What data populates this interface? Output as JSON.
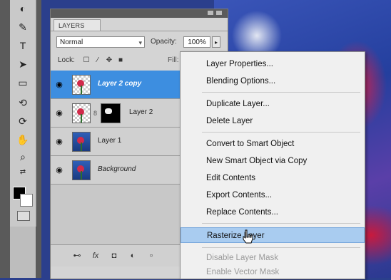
{
  "panel": {
    "tab_label": "LAYERS",
    "blend_mode": "Normal",
    "opacity_label": "Opacity:",
    "opacity_value": "100%",
    "lock_label": "Lock:",
    "fill_label": "Fill:",
    "layers": [
      {
        "name": "Layer 2 copy",
        "selected": true,
        "visible": true
      },
      {
        "name": "Layer 2",
        "selected": false,
        "visible": true,
        "has_mask": true
      },
      {
        "name": "Layer 1",
        "selected": false,
        "visible": true
      },
      {
        "name": "Background",
        "selected": false,
        "visible": true
      }
    ]
  },
  "context_menu": {
    "items": [
      {
        "label": "Layer Properties...",
        "state": "enabled"
      },
      {
        "label": "Blending Options...",
        "state": "enabled"
      },
      {
        "label": "Duplicate Layer...",
        "state": "enabled"
      },
      {
        "label": "Delete Layer",
        "state": "enabled"
      },
      {
        "label": "Convert to Smart Object",
        "state": "enabled"
      },
      {
        "label": "New Smart Object via Copy",
        "state": "enabled"
      },
      {
        "label": "Edit Contents",
        "state": "enabled"
      },
      {
        "label": "Export Contents...",
        "state": "enabled"
      },
      {
        "label": "Replace Contents...",
        "state": "enabled"
      },
      {
        "label": "Rasterize Layer",
        "state": "highlighted"
      },
      {
        "label": "Disable Layer Mask",
        "state": "disabled"
      },
      {
        "label": "Enable Vector Mask",
        "state": "disabled"
      }
    ]
  },
  "colors": {
    "selected_layer": "#3d8ee0",
    "menu_highlight": "#a9ccf0",
    "foreground_swatch": "#000000",
    "background_swatch": "#ffffff"
  }
}
